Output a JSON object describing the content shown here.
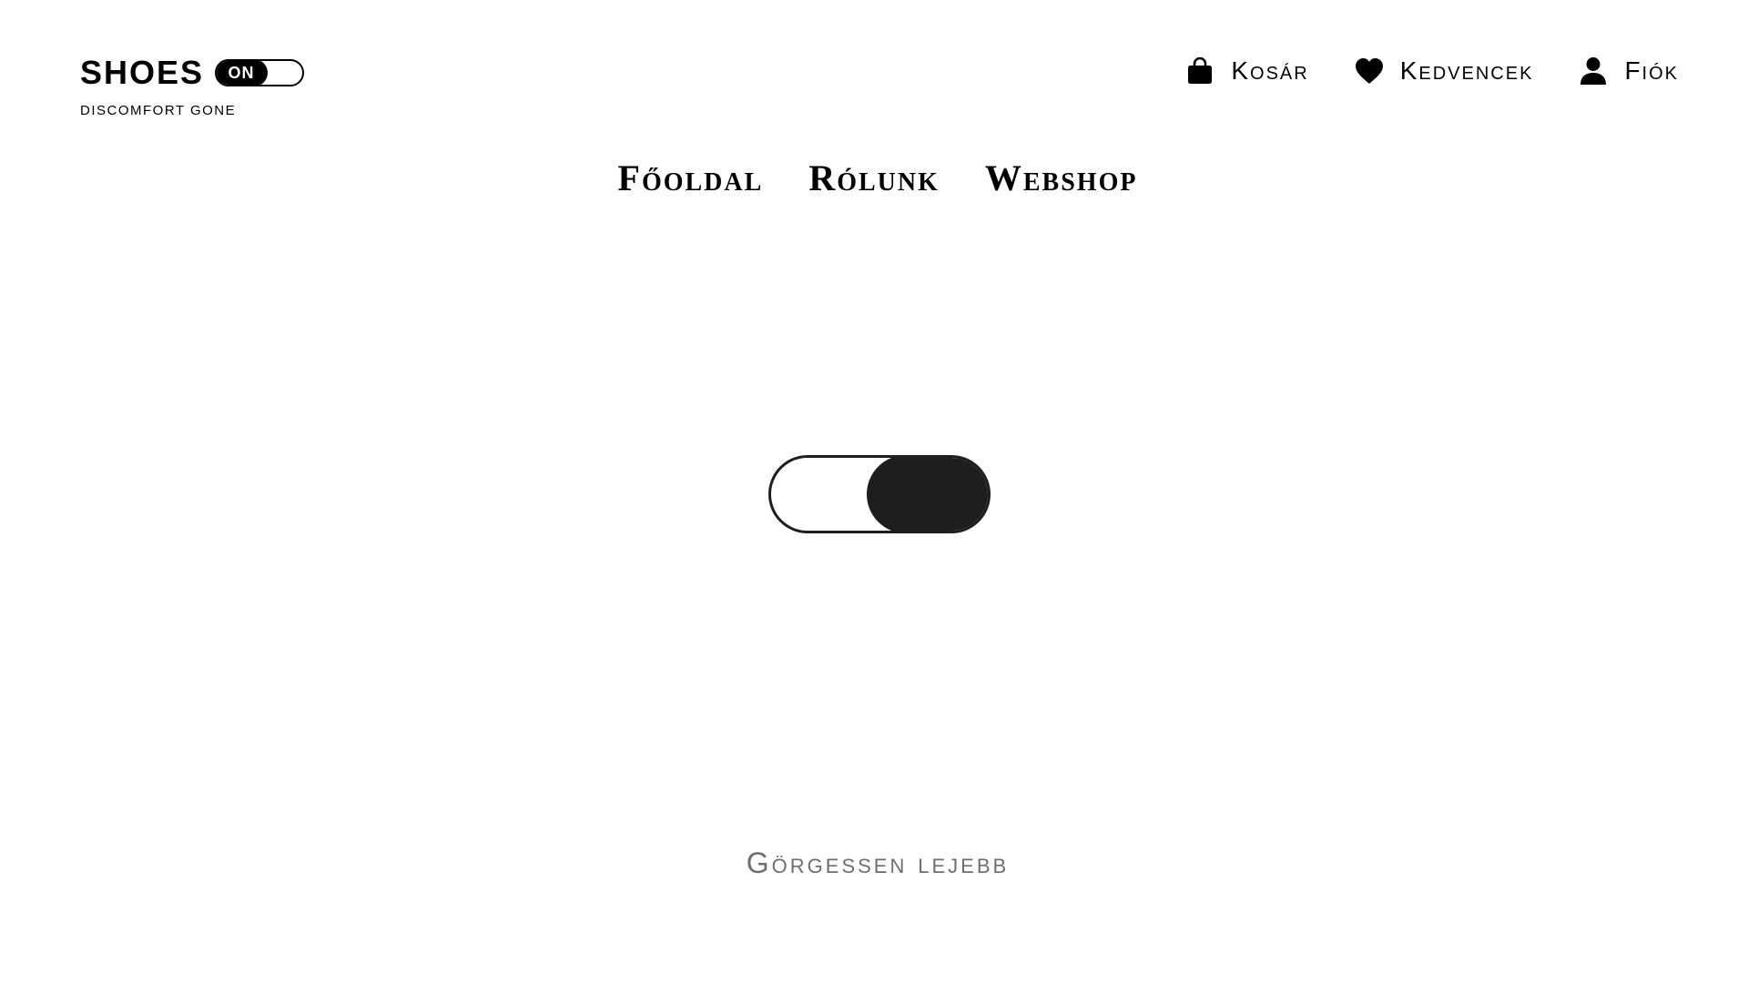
{
  "logo": {
    "word": "SHOES",
    "toggle_label": "ON",
    "tagline": "DISCOMFORT GONE"
  },
  "actions": [
    {
      "icon": "shopping-bag-icon",
      "label": "Kosár"
    },
    {
      "icon": "heart-icon",
      "label": "Kedvencek"
    },
    {
      "icon": "user-icon",
      "label": "Fiók"
    }
  ],
  "nav": {
    "items": [
      {
        "label": "Főoldal"
      },
      {
        "label": "Rólunk"
      },
      {
        "label": "Webshop"
      }
    ]
  },
  "hero_toggle": {
    "state": "on"
  },
  "scroll_hint": "Görgessen lejebb"
}
